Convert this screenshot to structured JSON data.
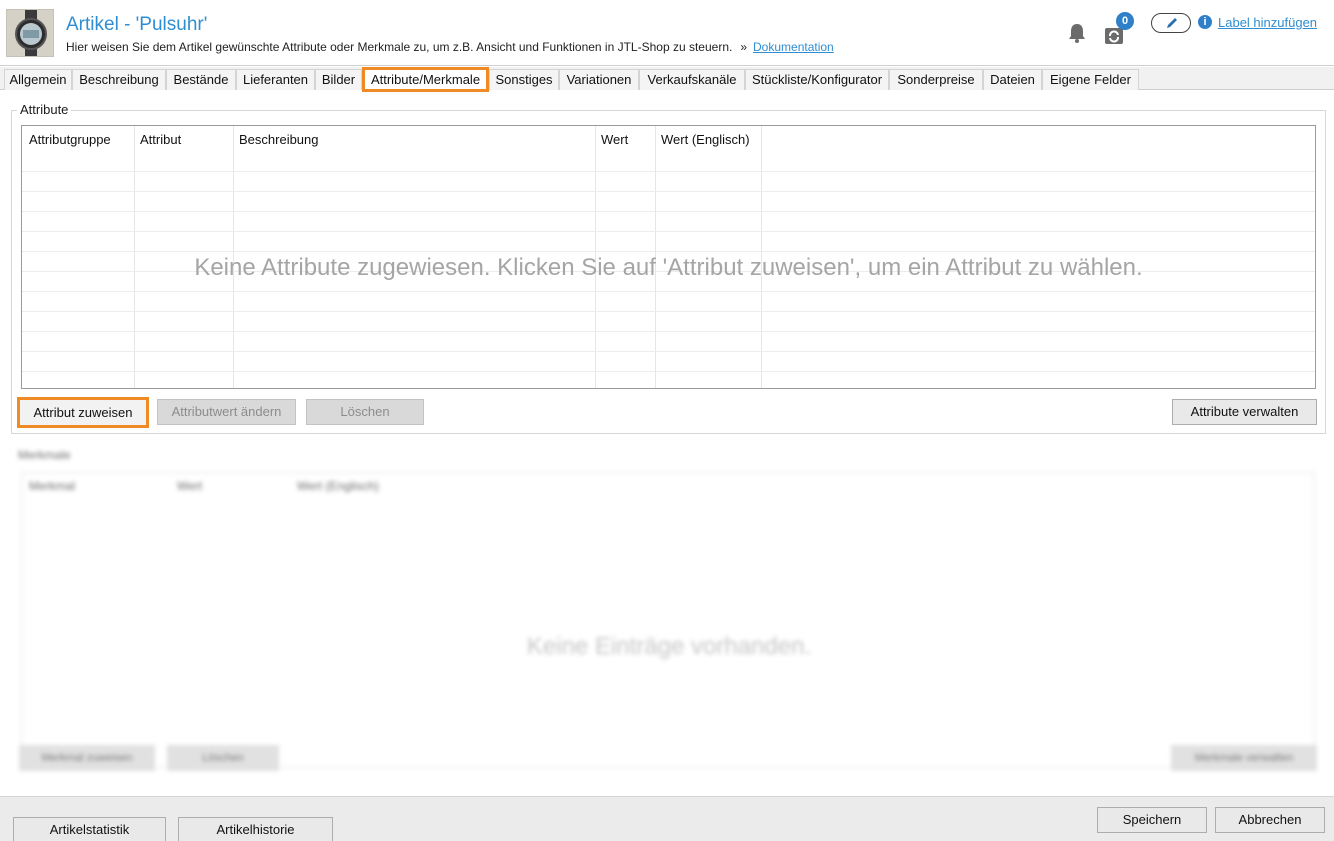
{
  "header": {
    "title": "Artikel - 'Pulsuhr'",
    "subtitle": "Hier weisen Sie dem Artikel gewünschte Attribute oder Merkmale zu, um z.B. Ansicht und Funktionen in JTL-Shop zu steuern.",
    "separator": "»",
    "doc_link": "Dokumentation",
    "notification_icon": "bell-icon",
    "sync_icon": "sync-icon",
    "sync_badge": "0",
    "edit_icon": "pencil-icon",
    "info_icon": "i",
    "label_link": "Label hinzufügen"
  },
  "tabs": [
    {
      "label": "Allgemein"
    },
    {
      "label": "Beschreibung"
    },
    {
      "label": "Bestände"
    },
    {
      "label": "Lieferanten"
    },
    {
      "label": "Bilder"
    },
    {
      "label": "Attribute/Merkmale",
      "active": true
    },
    {
      "label": "Sonstiges"
    },
    {
      "label": "Variationen"
    },
    {
      "label": "Verkaufskanäle"
    },
    {
      "label": "Stückliste/Konfigurator"
    },
    {
      "label": "Sonderpreise"
    },
    {
      "label": "Dateien"
    },
    {
      "label": "Eigene Felder"
    }
  ],
  "attributes": {
    "group_title": "Attribute",
    "columns": [
      "Attributgruppe",
      "Attribut",
      "Beschreibung",
      "Wert",
      "Wert (Englisch)"
    ],
    "empty_message": "Keine Attribute zugewiesen. Klicken Sie auf 'Attribut zuweisen', um ein Attribut zu wählen.",
    "buttons": {
      "assign": "Attribut zuweisen",
      "change_value": "Attributwert ändern",
      "delete": "Löschen",
      "manage": "Attribute verwalten"
    }
  },
  "features": {
    "group_title": "Merkmale",
    "columns": [
      "Merkmal",
      "Wert",
      "Wert (Englisch)"
    ],
    "empty_message": "Keine Einträge vorhanden.",
    "buttons": {
      "assign": "Merkmal zuweisen",
      "delete": "Löschen",
      "manage": "Merkmale verwalten"
    }
  },
  "footer": {
    "statistics": "Artikelstatistik",
    "history": "Artikelhistorie",
    "save": "Speichern",
    "cancel": "Abbrechen"
  }
}
